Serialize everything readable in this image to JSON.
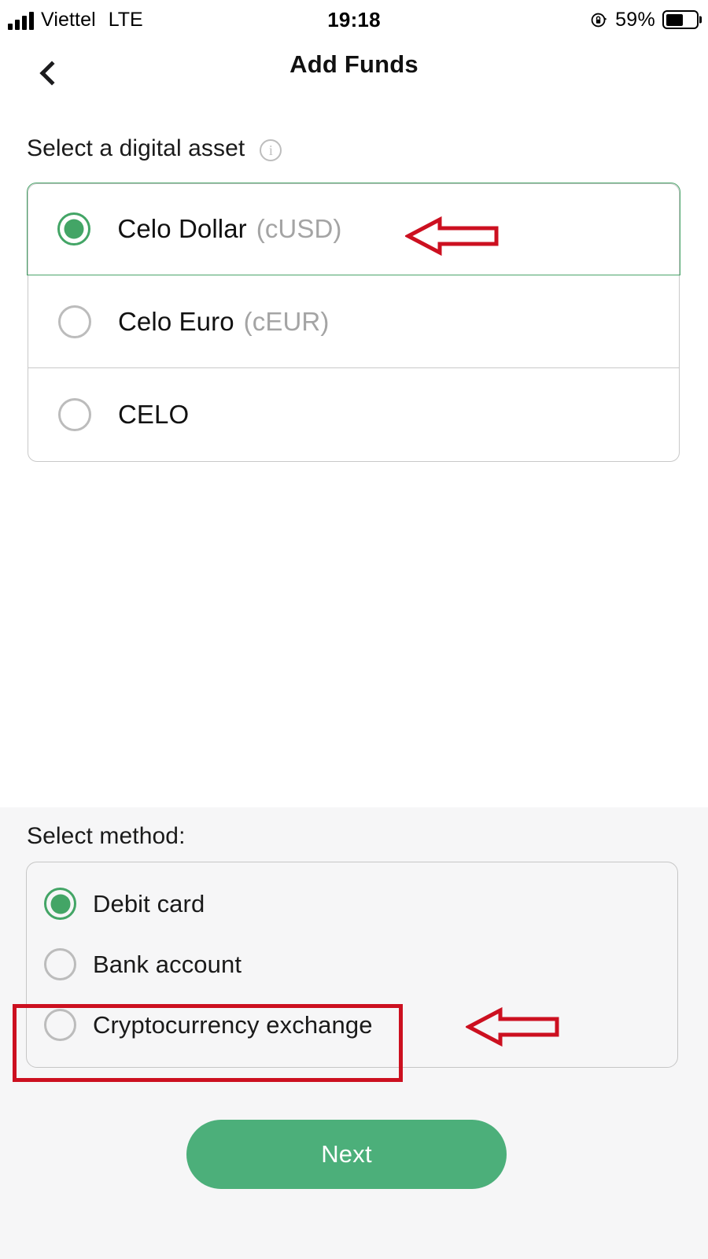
{
  "status_bar": {
    "carrier": "Viettel",
    "network": "LTE",
    "time": "19:18",
    "battery_percent": "59%",
    "battery_level": 59,
    "signal_bars": 4,
    "rotation_lock_icon": "rotation-lock-icon",
    "battery_icon": "battery-icon"
  },
  "nav": {
    "back_icon": "chevron-left-icon",
    "title": "Add Funds"
  },
  "asset_section": {
    "title": "Select a digital asset",
    "info_icon": "info-circle-icon",
    "options": [
      {
        "name": "Celo Dollar",
        "ticker": "(cUSD)",
        "selected": true
      },
      {
        "name": "Celo Euro",
        "ticker": "(cEUR)",
        "selected": false
      },
      {
        "name": "CELO",
        "ticker": "",
        "selected": false
      }
    ]
  },
  "method_section": {
    "title": "Select method:",
    "options": [
      {
        "label": "Debit card",
        "selected": true
      },
      {
        "label": "Bank account",
        "selected": false
      },
      {
        "label": "Cryptocurrency exchange",
        "selected": false
      }
    ]
  },
  "footer": {
    "next_label": "Next"
  },
  "annotations": {
    "arrow_color": "#cc1020",
    "rect_color": "#cc1020",
    "arrow_asset_points_to": "Celo Dollar (cUSD)",
    "arrow_method_points_to": "Cryptocurrency exchange",
    "highlight_box_target": "Cryptocurrency exchange"
  },
  "colors": {
    "accent_green": "#43a566",
    "button_green": "#4caf7a",
    "selected_border": "#4aa46a",
    "panel_bg": "#f6f6f7",
    "muted_text": "#a4a4a4"
  }
}
